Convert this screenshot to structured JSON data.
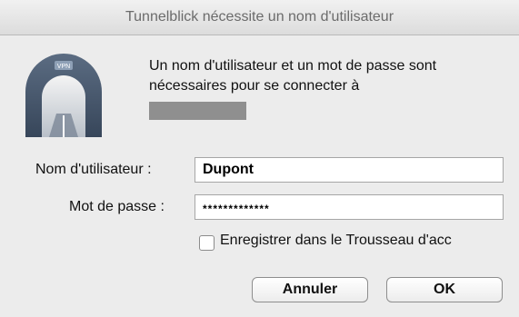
{
  "dialog": {
    "title": "Tunnelblick nécessite un nom d'utilisateur",
    "message": "Un nom d'utilisateur et un mot de passe sont nécessaires pour se connecter à",
    "icon_badge": "VPN"
  },
  "form": {
    "username_label": "Nom d'utilisateur :",
    "username_value": "Dupont",
    "password_label": "Mot de passe :",
    "password_value": "*************",
    "save_keychain_label": "Enregistrer dans le Trousseau d'acc",
    "save_keychain_checked": false
  },
  "buttons": {
    "cancel_label": "Annuler",
    "ok_label": "OK"
  }
}
